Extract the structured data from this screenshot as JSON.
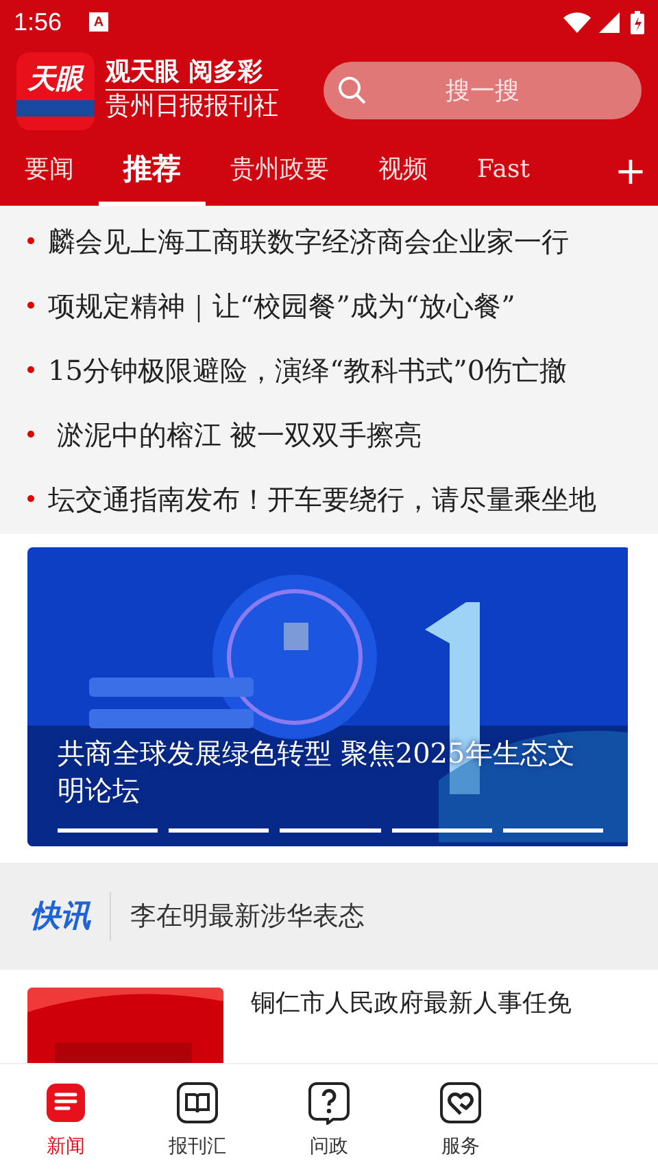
{
  "status_bar": {
    "time": "1:56",
    "notification_icon": "A"
  },
  "header": {
    "logo_text": "天眼",
    "brand_line1": "观天眼 阅多彩",
    "brand_line2": "贵州日报报刊社",
    "search": {
      "placeholder": "搜一搜"
    }
  },
  "tabs": [
    {
      "label": "要闻",
      "selected": false
    },
    {
      "label": "推荐",
      "selected": true
    },
    {
      "label": "贵州政要",
      "selected": false
    },
    {
      "label": "视频",
      "selected": false
    },
    {
      "label": "Fast",
      "selected": false
    }
  ],
  "add_tab": "+",
  "headlines": [
    "麟会见上海工商联数字经济商会企业家一行",
    "项规定精神｜让“校园餐”成为“放心餐”",
    "15分钟极限避险，演绎“教科书式”0伤亡撤",
    " 淤泥中的榕江 被一双双手擦亮",
    "坛交通指南发布！开车要绕行，请尽量乘坐地"
  ],
  "banner": {
    "kind": "picture",
    "caption": "共商全球发展绿色转型 聚焦2025年生态文明论坛",
    "indicators": [
      {
        "selected": false
      },
      {
        "selected": false
      },
      {
        "selected": false
      },
      {
        "selected": false
      },
      {
        "selected": false
      }
    ]
  },
  "flash": {
    "label": "快讯",
    "text": "李在明最新涉华表态"
  },
  "article": {
    "kind": "picture",
    "title": "铜仁市人民政府最新人事任免"
  },
  "bottom_nav": [
    {
      "label": "新闻",
      "kind": "news",
      "selected": true
    },
    {
      "label": "报刊汇",
      "kind": "book",
      "selected": false
    },
    {
      "label": "问政",
      "kind": "question",
      "selected": false
    },
    {
      "label": "服务",
      "kind": "heart",
      "selected": false
    }
  ]
}
